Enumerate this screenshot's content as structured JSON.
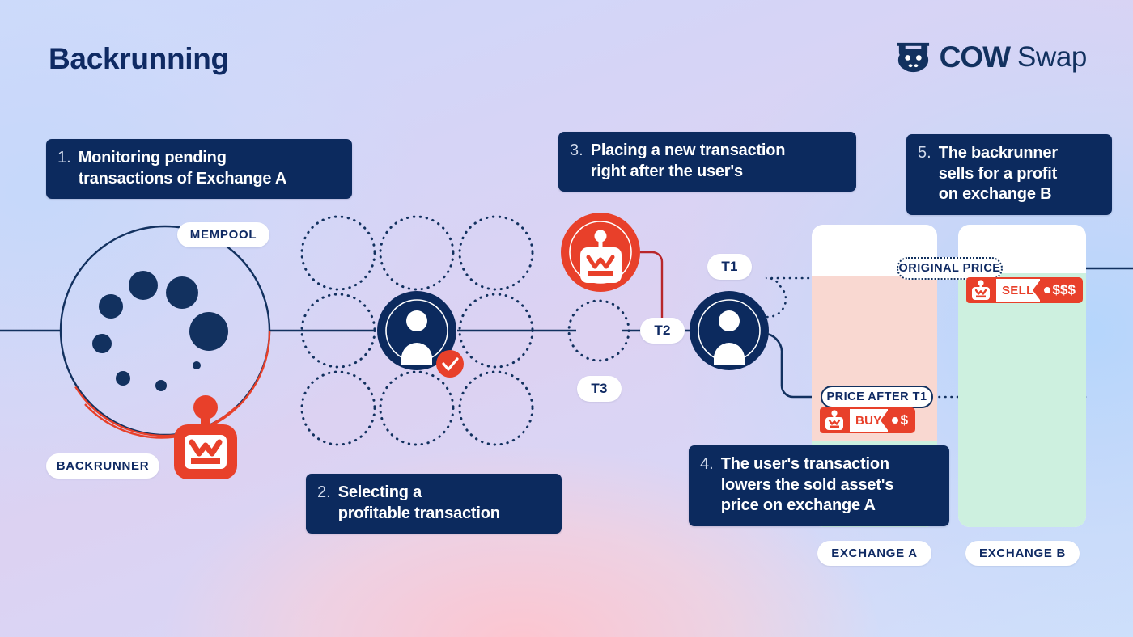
{
  "page": {
    "title": "Backrunning",
    "brand": {
      "name": "COW",
      "suffix": "Swap",
      "logo_icon": "cow-head-icon"
    }
  },
  "colors": {
    "navy": "#0c2a5e",
    "navy_text": "#0f2a63",
    "red": "#e8402a",
    "white": "#ffffff",
    "panel_pink": "#f9d8d1",
    "panel_green": "#cdf0df"
  },
  "steps": [
    {
      "num": "1.",
      "text": "Monitoring pending\ntransactions of Exchange A"
    },
    {
      "num": "2.",
      "text": "Selecting a\nprofitable transaction"
    },
    {
      "num": "3.",
      "text": "Placing a new transaction\nright after the user's"
    },
    {
      "num": "4.",
      "text": "The user's transaction\nlowers the sold asset's\nprice on exchange A"
    },
    {
      "num": "5.",
      "text": "The backrunner\nsells for a profit\non exchange B"
    }
  ],
  "labels": {
    "mempool": "MEMPOOL",
    "backrunner": "BACKRUNNER",
    "t1": "T1",
    "t2": "T2",
    "t3": "T3",
    "exchange_a": "EXCHANGE A",
    "exchange_b": "EXCHANGE B",
    "original_price": "ORIGINAL PRICE",
    "price_after_t1": "PRICE AFTER T1"
  },
  "tags": {
    "buy": {
      "action": "BUY",
      "price": "$",
      "icon": "bot-icon"
    },
    "sell": {
      "action": "SELL",
      "price": "$$$",
      "icon": "bot-icon"
    }
  },
  "icons": {
    "mempool_circle": "mempool-circle",
    "backrunner_bot": "bot-icon",
    "user_avatar": "user-avatar-icon",
    "check_badge": "check-badge-icon",
    "chevron_down": "chevron-down-icon"
  }
}
